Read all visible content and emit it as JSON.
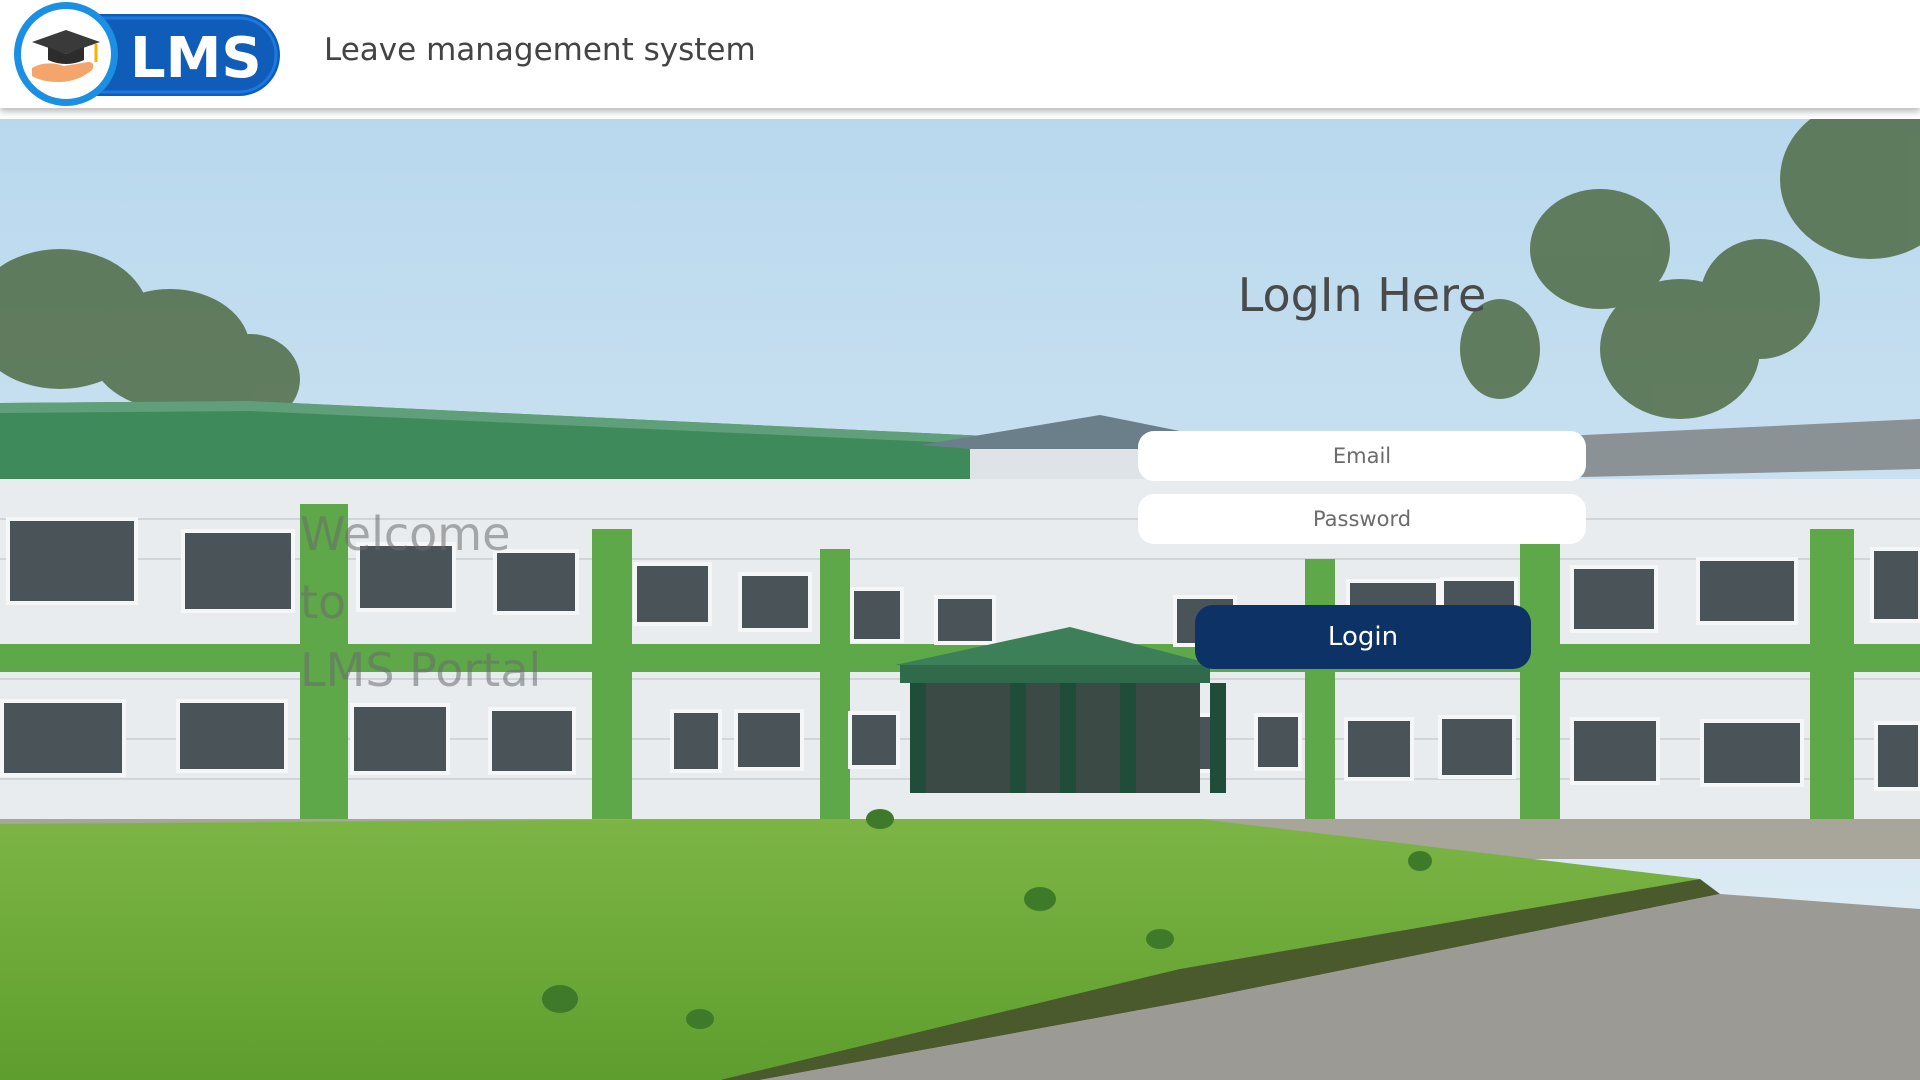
{
  "header": {
    "logo_text": "LMS",
    "site_title": "Leave management system"
  },
  "welcome": {
    "line1": "Welcome",
    "line2": "to",
    "line3": "LMS Portal"
  },
  "login": {
    "title": "LogIn Here",
    "email_placeholder": "Email",
    "password_placeholder": "Password",
    "email_value": "",
    "password_value": "",
    "button_label": "Login"
  },
  "colors": {
    "button": "#0d3266",
    "logo_blue": "#0f5db8",
    "roof_green": "#3f8a5a",
    "pillar_green": "#5ea84a",
    "lawn_green": "#6fae3c"
  }
}
